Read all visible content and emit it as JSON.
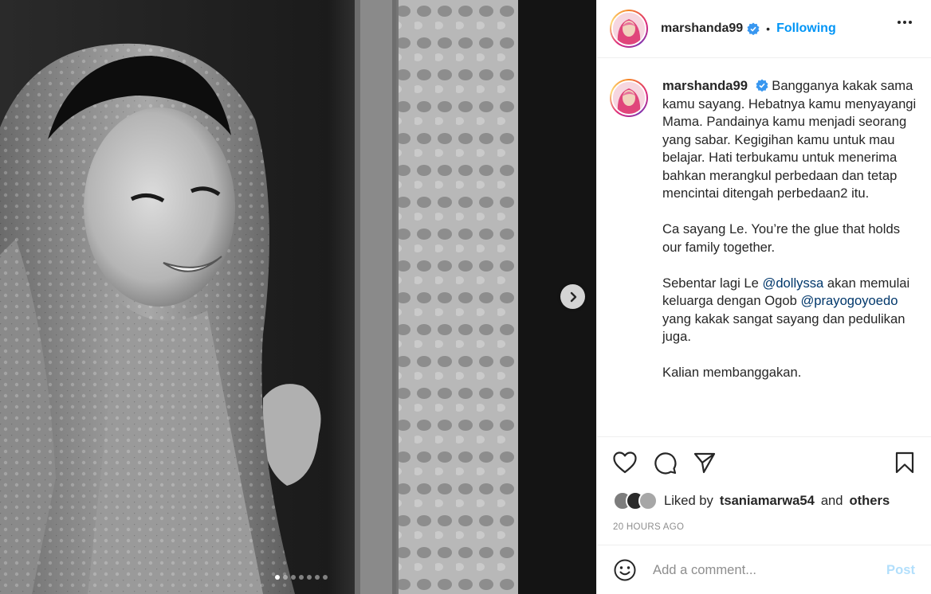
{
  "post": {
    "username": "marshanda99",
    "follow_status": "Following",
    "separator": "•",
    "caption": [
      "Bangganya kakak sama kamu sayang. Hebatnya kamu menyayangi Mama. Pandainya kamu menjadi seorang yang sabar. Kegigihan kamu untuk mau belajar. Hati terbukamu untuk menerima bahkan merangkul perbedaan dan tetap mencintai ditengah perbedaan2 itu.",
      "Ca sayang Le. You’re the glue that holds our family together.",
      {
        "before": "Sebentar lagi Le ",
        "mention1": "@dollyssa",
        "middle": " akan memulai keluarga dengan Ogob ",
        "mention2": "@prayogoyoedo",
        "after": " yang kakak sangat sayang dan pedulikan juga."
      },
      "Kalian membanggakan."
    ],
    "likes": {
      "prefix": "Liked by",
      "user": "tsaniamarwa54",
      "joiner": "and",
      "others": "others"
    },
    "timestamp": "20 HOURS AGO",
    "comment": {
      "placeholder": "Add a comment...",
      "post_label": "Post"
    },
    "carousel": {
      "slides": 7,
      "active_index": 0
    }
  },
  "colors": {
    "link_blue": "#0095f6",
    "mention": "#00376b",
    "verified": "#3897f0",
    "post_disabled": "#b2dffc"
  },
  "icons": [
    "verified-badge-icon",
    "more-options-icon",
    "heart-icon",
    "comment-icon",
    "share-icon",
    "bookmark-icon",
    "emoji-icon",
    "chevron-right-icon"
  ]
}
